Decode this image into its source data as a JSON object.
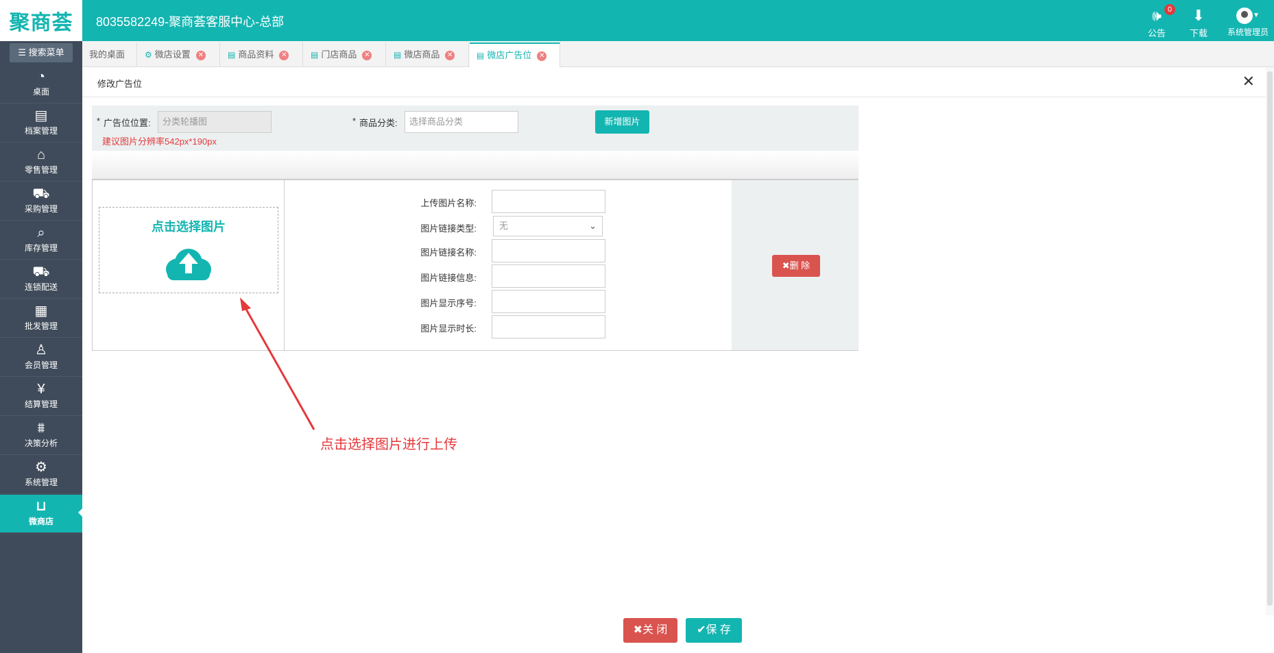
{
  "app": {
    "logo": "聚商荟",
    "title": "8035582249-聚商荟客服中心-总部"
  },
  "top_actions": {
    "notice": {
      "label": "公告",
      "count": "0",
      "icon": "speaker-icon"
    },
    "download": {
      "label": "下载",
      "icon": "download-icon"
    },
    "user": {
      "label": "系统管理员",
      "icon": "avatar-icon"
    }
  },
  "sidebar": {
    "search_label": "搜索菜单",
    "items": [
      {
        "label": "桌面",
        "icon": "dashboard-icon"
      },
      {
        "label": "档案管理",
        "icon": "clipboard-icon"
      },
      {
        "label": "零售管理",
        "icon": "store-icon"
      },
      {
        "label": "采购管理",
        "icon": "cart-icon"
      },
      {
        "label": "库存管理",
        "icon": "inventory-search-icon"
      },
      {
        "label": "连锁配送",
        "icon": "truck-icon"
      },
      {
        "label": "批发管理",
        "icon": "document-icon"
      },
      {
        "label": "会员管理",
        "icon": "member-icon"
      },
      {
        "label": "结算管理",
        "icon": "yen-icon"
      },
      {
        "label": "决策分析",
        "icon": "chart-icon"
      },
      {
        "label": "系统管理",
        "icon": "gear-icon"
      },
      {
        "label": "微商店",
        "icon": "bag-icon"
      }
    ]
  },
  "tabs": [
    {
      "label": "我的桌面"
    },
    {
      "label": "微店设置"
    },
    {
      "label": "商品资料"
    },
    {
      "label": "门店商品"
    },
    {
      "label": "微店商品"
    },
    {
      "label": "微店广告位"
    }
  ],
  "panel": {
    "title": "修改广告位",
    "close_glyph": "✕"
  },
  "form": {
    "position_label": "广告位位置:",
    "position_value": "分类轮播图",
    "category_label": "商品分类:",
    "category_placeholder": "选择商品分类",
    "required_mark": "*",
    "hint": "建议图片分辨率542px*190px",
    "add_image_label": "新增图片"
  },
  "image_item": {
    "upload_text": "点击选择图片",
    "fields": [
      {
        "label": "上传图片名称:"
      },
      {
        "label": "图片链接类型:",
        "value": "无"
      },
      {
        "label": "图片链接名称:"
      },
      {
        "label": "图片链接信息:"
      },
      {
        "label": "图片显示序号:"
      },
      {
        "label": "图片显示时长:"
      }
    ],
    "delete_label": "✖删 除"
  },
  "annotation": "点击选择图片进行上传",
  "footer": {
    "close_label": "✖关 闭",
    "save_label": "✔保 存"
  },
  "colors": {
    "brand": "#13b5b1",
    "sidebar": "#3f4b5a",
    "danger": "#d9534f"
  }
}
